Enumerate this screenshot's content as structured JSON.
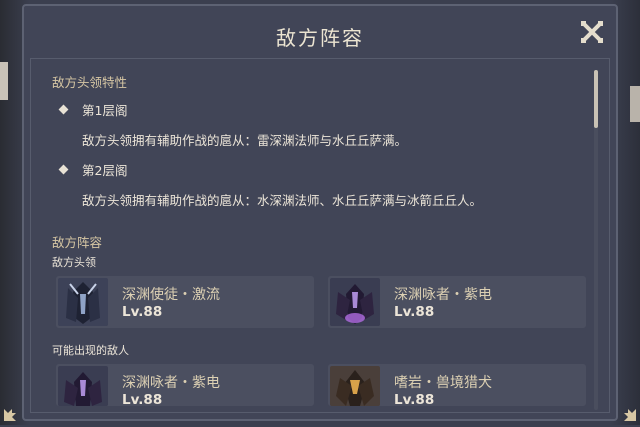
{
  "window": {
    "title": "敌方阵容"
  },
  "boss_section": {
    "heading": "敌方头领特性",
    "floors": [
      {
        "label": "第1层阁",
        "desc": "敌方头领拥有辅助作战的扈从：雷深渊法师与水丘丘萨满。"
      },
      {
        "label": "第2层阁",
        "desc": "敌方头领拥有辅助作战的扈从：水深渊法师、水丘丘萨满与冰箭丘丘人。"
      }
    ]
  },
  "lineup_section": {
    "heading": "敌方阵容",
    "boss_label": "敌方头领",
    "bosses": [
      {
        "name": "深渊使徒・激流",
        "level": "Lv.88",
        "icon": "abyss-herald-portrait"
      },
      {
        "name": "深渊咏者・紫电",
        "level": "Lv.88",
        "icon": "abyss-lector-electro-portrait"
      }
    ],
    "possible_label": "可能出现的敌人",
    "enemies": [
      {
        "name": "深渊咏者・紫电",
        "level": "Lv.88",
        "icon": "abyss-lector-electro-portrait"
      },
      {
        "name": "嗜岩・兽境猎犬",
        "level": "Lv.88",
        "icon": "rockfond-rifthound-portrait"
      }
    ]
  },
  "icons": {
    "close": "close-icon",
    "floor_bullet": "diamond-icon"
  },
  "colors": {
    "panel": "#414557",
    "accent": "#d7c7a4",
    "text": "#ece5d8"
  }
}
